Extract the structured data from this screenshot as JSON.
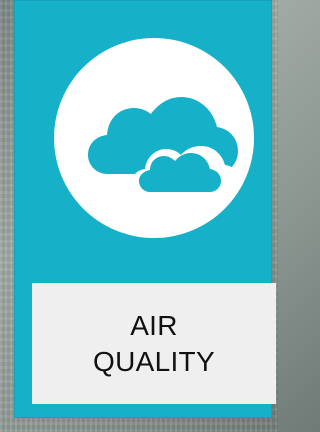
{
  "tile": {
    "title_line_1": "AIR",
    "title_line_2": "QUALITY",
    "icon": "cloud-icon"
  },
  "colors": {
    "accent": "#16b0c9",
    "icon_background": "#ffffff",
    "label_background": "#efefef",
    "label_text": "#111111"
  }
}
